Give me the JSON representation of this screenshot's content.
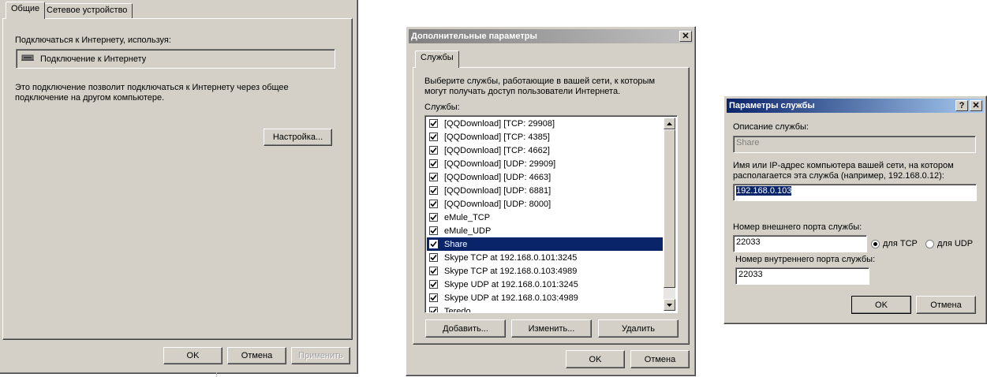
{
  "colors": {
    "face": "#d4d0c8",
    "selection": "#0a246a",
    "title_gradient_start": "#0a246a",
    "title_gradient_end": "#a6caf0"
  },
  "props_dialog": {
    "tabs": [
      "Общие",
      "Сетевое устройство"
    ],
    "connect_using_label": "Подключаться к Интернету, используя:",
    "connection_name": "Подключение к Интернету",
    "connection_icon": "network-adapter-icon",
    "description": "Это подключение позволит подключаться к Интернету через общее подключение на другом компьютере.",
    "settings_button": "Настройка...",
    "ok": "OK",
    "cancel": "Отмена",
    "apply": "Применить"
  },
  "advanced_dialog": {
    "title": "Дополнительные параметры",
    "close_glyph": "✕",
    "tab": "Службы",
    "intro": "Выберите службы, работающие в вашей сети, к которым могут получать доступ пользователи Интернета.",
    "services_label": "Службы:",
    "services": [
      {
        "name": "[QQDownload] [TCP: 29908]",
        "checked": true,
        "selected": false
      },
      {
        "name": "[QQDownload] [TCP: 4385]",
        "checked": true,
        "selected": false
      },
      {
        "name": "[QQDownload] [TCP: 4662]",
        "checked": true,
        "selected": false
      },
      {
        "name": "[QQDownload] [UDP: 29909]",
        "checked": true,
        "selected": false
      },
      {
        "name": "[QQDownload] [UDP: 4663]",
        "checked": true,
        "selected": false
      },
      {
        "name": "[QQDownload] [UDP: 6881]",
        "checked": true,
        "selected": false
      },
      {
        "name": "[QQDownload] [UDP: 8000]",
        "checked": true,
        "selected": false
      },
      {
        "name": "eMule_TCP",
        "checked": true,
        "selected": false
      },
      {
        "name": "eMule_UDP",
        "checked": true,
        "selected": false
      },
      {
        "name": "Share",
        "checked": true,
        "selected": true
      },
      {
        "name": "Skype TCP at 192.168.0.101:3245",
        "checked": true,
        "selected": false
      },
      {
        "name": "Skype TCP at 192.168.0.103:4989",
        "checked": true,
        "selected": false
      },
      {
        "name": "Skype UDP at 192.168.0.101:3245",
        "checked": true,
        "selected": false
      },
      {
        "name": "Skype UDP at 192.168.0.103:4989",
        "checked": true,
        "selected": false
      },
      {
        "name": "Teredo",
        "checked": true,
        "selected": false
      }
    ],
    "add_button": "Добавить...",
    "edit_button": "Изменить...",
    "delete_button": "Удалить",
    "ok": "OK",
    "cancel": "Отмена"
  },
  "service_dialog": {
    "title": "Параметры службы",
    "help_glyph": "?",
    "close_glyph": "✕",
    "description_label": "Описание службы:",
    "description_value": "Share",
    "host_label": "Имя или IP-адрес компьютера вашей сети, на котором располагается эта служба (например, 192.168.0.12):",
    "host_value": "192.168.0.103",
    "external_port_label": "Номер внешнего порта службы:",
    "external_port_value": "22033",
    "protocol_tcp": "для TCP",
    "protocol_udp": "для UDP",
    "protocol_selected": "TCP",
    "internal_port_label": "Номер внутреннего порта службы:",
    "internal_port_value": "22033",
    "ok": "OK",
    "cancel": "Отмена"
  }
}
